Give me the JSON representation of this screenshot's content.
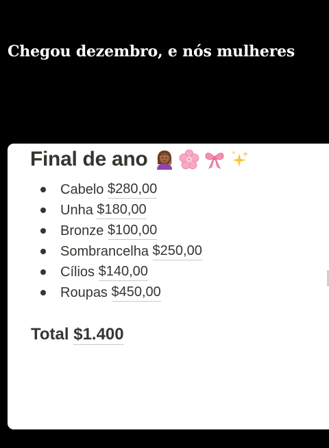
{
  "caption": "Chegou dezembro, e nós mulheres",
  "note": {
    "title": "Final de ano",
    "title_emojis": [
      "woman-tipping-hand-emoji",
      "cherry-blossom-emoji",
      "ribbon-emoji",
      "sparkles-emoji"
    ],
    "items": [
      {
        "label": "Cabelo",
        "amount": "$280,00"
      },
      {
        "label": "Unha",
        "amount": "$180,00"
      },
      {
        "label": "Bronze",
        "amount": "$100,00"
      },
      {
        "label": "Sombrancelha",
        "amount": "$250,00"
      },
      {
        "label": "Cílios",
        "amount": "$140,00"
      },
      {
        "label": "Roupas",
        "amount": "$450,00"
      }
    ],
    "total_label": "Total",
    "total_amount": "$1.400"
  },
  "colors": {
    "background": "#000000",
    "card": "#ffffff",
    "text": "#37352f",
    "caption_text": "#ffffff"
  }
}
